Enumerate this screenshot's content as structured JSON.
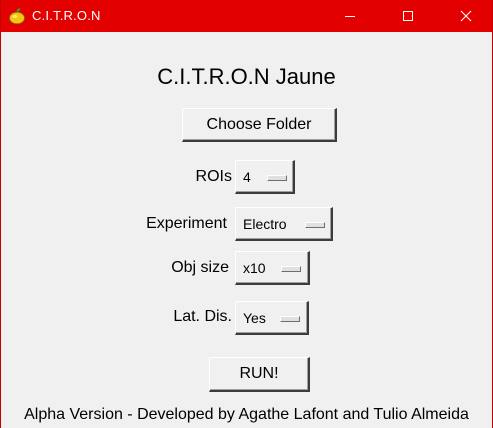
{
  "window": {
    "title": "C.I.T.R.O.N",
    "icon": "lemon-icon",
    "titlebar_color": "#e30000"
  },
  "app": {
    "heading": "C.I.T.R.O.N Jaune",
    "choose_folder_label": "Choose Folder",
    "run_label": "RUN!",
    "footer": "Alpha Version - Developed by Agathe Lafont and Tulio Almeida"
  },
  "options": {
    "rois": {
      "label": "ROIs",
      "value": "4"
    },
    "experiment": {
      "label": "Experiment",
      "value": "Electro"
    },
    "obj_size": {
      "label": "Obj size",
      "value": "x10"
    },
    "lat_dis": {
      "label": "Lat. Dis.",
      "value": "Yes"
    }
  }
}
